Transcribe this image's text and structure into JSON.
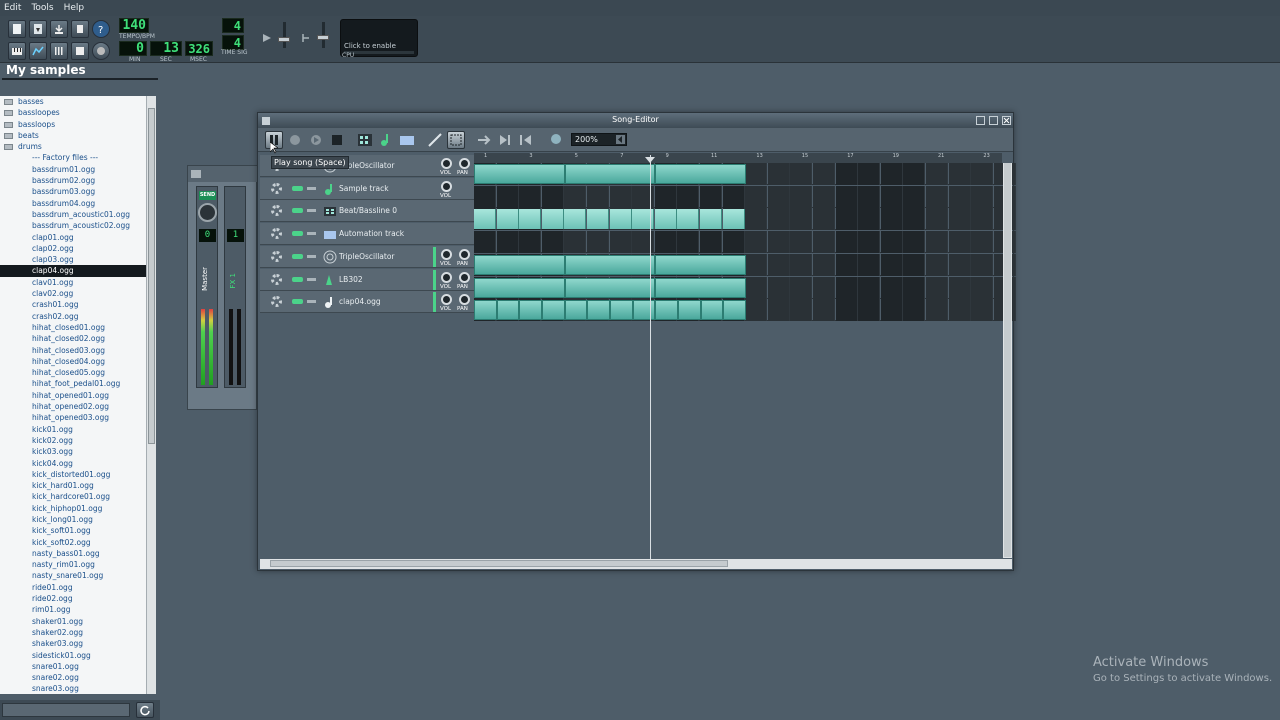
{
  "menu": [
    "Edit",
    "Tools",
    "Help"
  ],
  "toolbar": {
    "tempo_value": "140",
    "tempo_caption": "TEMPO/BPM",
    "timesig_top": "4",
    "timesig_bottom": "4",
    "timesig_caption": "TIME SIG",
    "time_min": "0",
    "time_sec": "13",
    "time_msec": "326",
    "cap_min": "MIN",
    "cap_sec": "SEC",
    "cap_msec": "MSEC",
    "cpu_message": "Click to enable",
    "cpu_caption": "CPU"
  },
  "sidebar": {
    "title": "My samples",
    "folders": [
      "basses",
      "bassloopes",
      "bassloops",
      "beats",
      "drums"
    ],
    "factory_label": "--- Factory files ---",
    "files": [
      "bassdrum01.ogg",
      "bassdrum02.ogg",
      "bassdrum03.ogg",
      "bassdrum04.ogg",
      "bassdrum_acoustic01.ogg",
      "bassdrum_acoustic02.ogg",
      "clap01.ogg",
      "clap02.ogg",
      "clap03.ogg",
      "clap04.ogg",
      "clav01.ogg",
      "clav02.ogg",
      "crash01.ogg",
      "crash02.ogg",
      "hihat_closed01.ogg",
      "hihat_closed02.ogg",
      "hihat_closed03.ogg",
      "hihat_closed04.ogg",
      "hihat_closed05.ogg",
      "hihat_foot_pedal01.ogg",
      "hihat_opened01.ogg",
      "hihat_opened02.ogg",
      "hihat_opened03.ogg",
      "kick01.ogg",
      "kick02.ogg",
      "kick03.ogg",
      "kick04.ogg",
      "kick_distorted01.ogg",
      "kick_hard01.ogg",
      "kick_hardcore01.ogg",
      "kick_hiphop01.ogg",
      "kick_long01.ogg",
      "kick_soft01.ogg",
      "kick_soft02.ogg",
      "nasty_bass01.ogg",
      "nasty_rim01.ogg",
      "nasty_snare01.ogg",
      "ride01.ogg",
      "ride02.ogg",
      "rim01.ogg",
      "shaker01.ogg",
      "shaker02.ogg",
      "shaker03.ogg",
      "sidestick01.ogg",
      "snare01.ogg",
      "snare02.ogg",
      "snare03.ogg"
    ],
    "selected_file": "clap04.ogg"
  },
  "mixer": {
    "send_label": "SEND",
    "master_value": "0",
    "fx1_value": "1",
    "master_name": "Master",
    "fx1_name": "FX 1"
  },
  "song_editor": {
    "title": "Song-Editor",
    "zoom": "200%",
    "tooltip": "Play song (Space)",
    "vol_label": "VOL",
    "pan_label": "PAN",
    "ruler_ticks": [
      "1",
      "3",
      "5",
      "7",
      "9",
      "11",
      "13",
      "15",
      "17",
      "19",
      "21",
      "23"
    ],
    "tracks": [
      {
        "name": "TripleOscillator",
        "icon": "oscillator-icon"
      },
      {
        "name": "Sample track",
        "icon": "sample-note-icon"
      },
      {
        "name": "Beat/Bassline 0",
        "icon": "beat-bassline-icon"
      },
      {
        "name": "Automation track",
        "icon": "automation-folder-icon"
      },
      {
        "name": "TripleOscillator",
        "icon": "oscillator-icon"
      },
      {
        "name": "LB302",
        "icon": "lb302-icon"
      },
      {
        "name": "clap04.ogg",
        "icon": "audio-file-icon"
      }
    ]
  },
  "watermark": {
    "line1": "Activate Windows",
    "line2": "Go to Settings to activate Windows."
  }
}
